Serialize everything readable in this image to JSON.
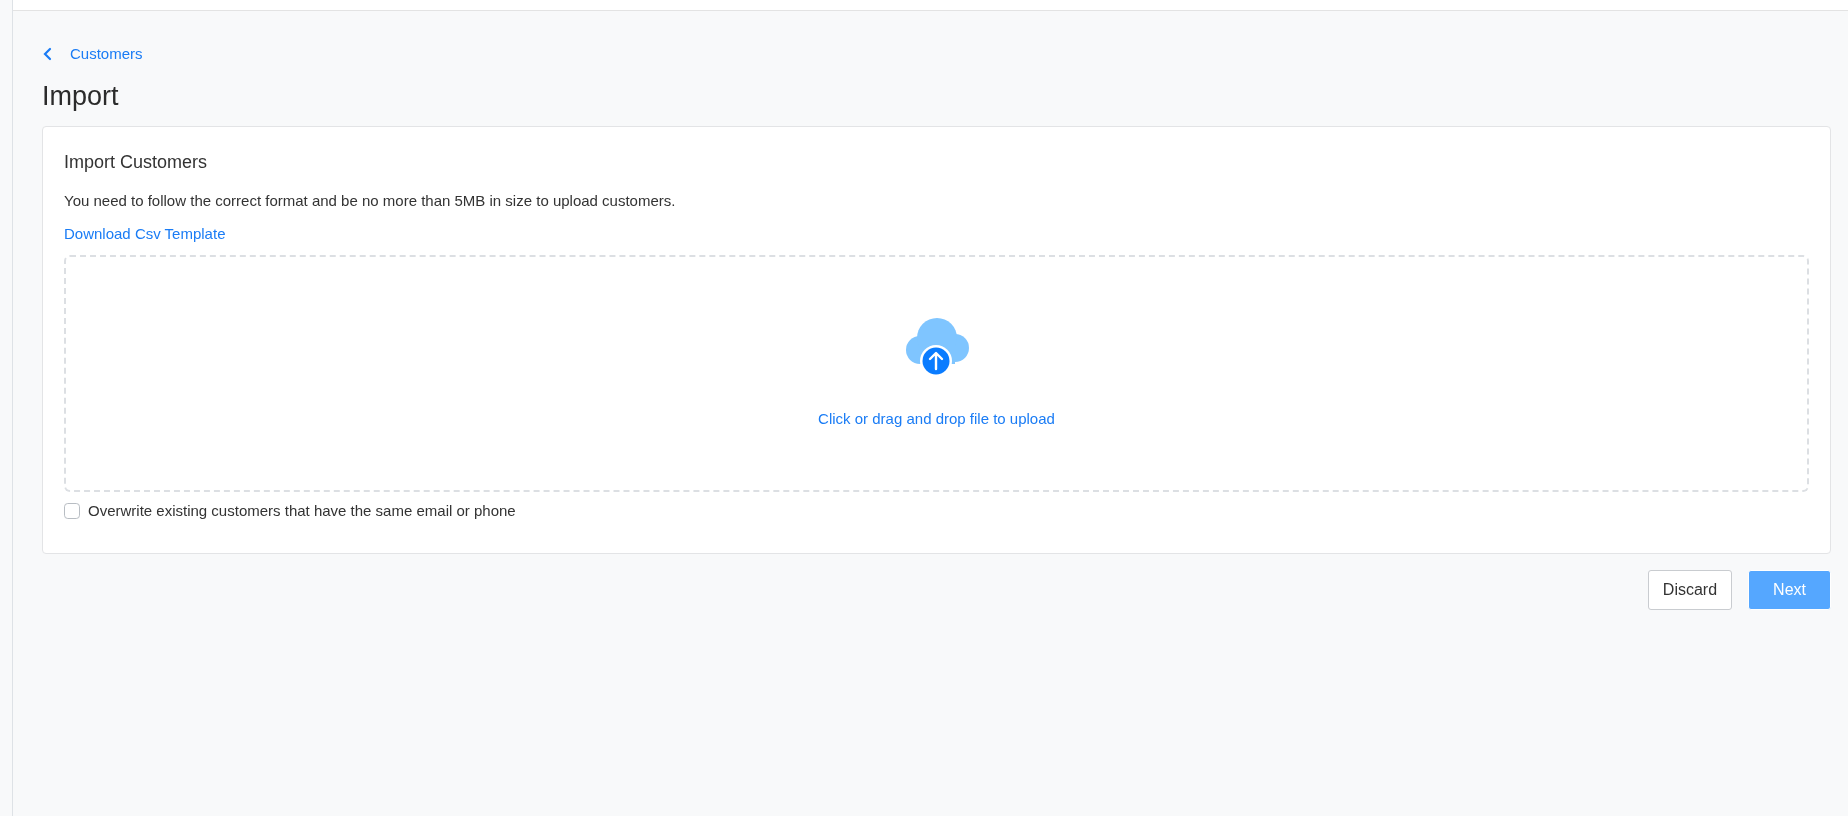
{
  "breadcrumb": {
    "label": "Customers"
  },
  "page_title": "Import",
  "card": {
    "title": "Import Customers",
    "description": "You need to follow the correct format and be no more than 5MB in size to upload customers.",
    "template_link": "Download Csv Template",
    "dropzone": {
      "label": "Click or drag and drop file to upload"
    },
    "overwrite": {
      "label": "Overwrite existing customers that have the same email or phone",
      "checked": false
    }
  },
  "buttons": [
    {
      "label": "Discard",
      "kind": "secondary",
      "disabled": false
    },
    {
      "label": "Next",
      "kind": "primary",
      "disabled": true
    }
  ]
}
